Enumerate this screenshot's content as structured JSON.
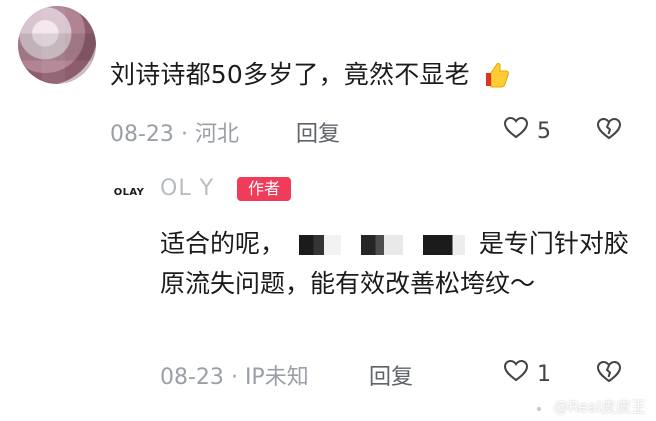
{
  "comment_top": {
    "text": "刘诗诗都50多岁了，竟然不显老",
    "emoji": "thumbs-up-icon",
    "date": "08-23",
    "dot": "·",
    "location": "河北",
    "reply_label": "回复",
    "like_count": "5"
  },
  "reply": {
    "brand_avatar_text": "OLAY",
    "brand_name_partial": "OL Y",
    "author_badge": "作者",
    "text_before": "适合的呢，",
    "text_after": "是专门针对胶原流失问题，能有效改善松垮纹～",
    "date": "08-23",
    "dot": "·",
    "location": "IP未知",
    "reply_label": "回复",
    "like_count": "1"
  },
  "watermark": {
    "text": "@Real皮皮王"
  },
  "colors": {
    "badge": "#f13b5a",
    "meta": "#9aa0a6",
    "text": "#1b1b1b"
  }
}
